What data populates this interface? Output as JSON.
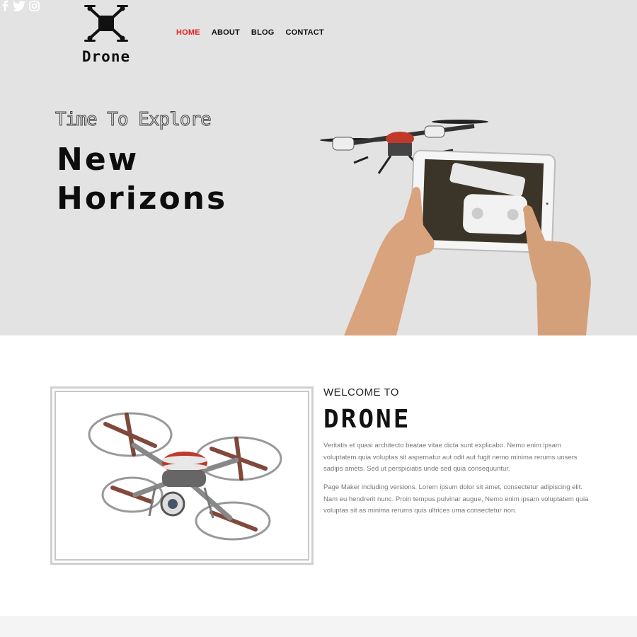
{
  "header": {
    "logo_text": "Drone",
    "nav": [
      {
        "label": "HOME",
        "active": true
      },
      {
        "label": "ABOUT",
        "active": false
      },
      {
        "label": "BLOG",
        "active": false
      },
      {
        "label": "CONTACT",
        "active": false
      }
    ],
    "social": [
      {
        "icon": "facebook-icon",
        "glyph": "f"
      },
      {
        "icon": "twitter-icon",
        "glyph": "t"
      },
      {
        "icon": "instagram-icon",
        "glyph": "i"
      }
    ],
    "active_color": "#e02020"
  },
  "hero": {
    "tagline": "Time To Explore",
    "headline_line1": "New",
    "headline_line2": "Horizons",
    "background": "#e3e3e3"
  },
  "about": {
    "welcome": "WELCOME TO",
    "brand": "DRONE",
    "paragraph1": "Veritatis et quasi architecto beatae vitae dicta sunt explicabo. Nemo enim ipsam voluptatem quia voluptas sit aspernatur aut odit aut fugit nemo minima rerums unsers sadips amets. Sed ut perspiciatis unde sed quia consequuntur.",
    "paragraph2": "Page Maker including versions. Lorem ipsum dolor sit amet, consectetur adipiscing elit. Nam eu hendrerit nunc. Proin tempus pulvinar augue, Nemo enim ipsam voluptatem quia voluptas sit as minima rerums quis ultrices urna consectetur non."
  }
}
